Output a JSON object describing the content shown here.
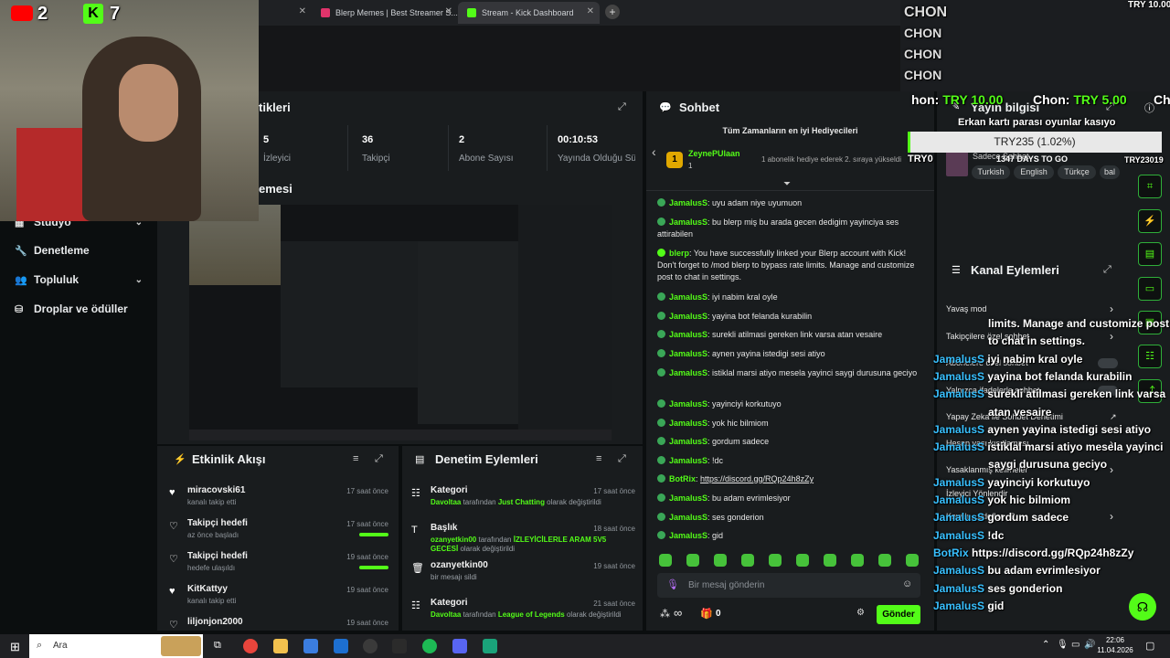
{
  "browser": {
    "tabs": [
      {
        "label": "Blerp Memes | Best Streamer S..."
      },
      {
        "label": "Stream - Kick Dashboard"
      }
    ]
  },
  "counters": {
    "youtube": "2",
    "kick": "7"
  },
  "sidebar": {
    "items": [
      {
        "label": "Stüdyo",
        "icon": "studio-icon"
      },
      {
        "label": "Denetleme",
        "icon": "wrench-icon"
      },
      {
        "label": "Topluluk",
        "icon": "community-icon"
      },
      {
        "label": "Droplar ve ödüller",
        "icon": "drops-icon"
      }
    ]
  },
  "stats": {
    "title": "tikleri",
    "items": [
      {
        "value": "5",
        "label": "İzleyici"
      },
      {
        "value": "36",
        "label": "Takipçi"
      },
      {
        "value": "2",
        "label": "Abone Sayısı"
      },
      {
        "value": "00:10:53",
        "label": "Yayında Olduğu Süre"
      }
    ]
  },
  "preview": {
    "title": "emesi"
  },
  "activity": {
    "title": "Etkinlik Akışı",
    "items": [
      {
        "name": "miracovski61",
        "sub": "kanalı takip etti",
        "time": "17 saat önce",
        "bar": 0
      },
      {
        "name": "Takipçi hedefi",
        "sub": "az önce başladı",
        "time": "17 saat önce",
        "bar": 1
      },
      {
        "name": "Takipçi hedefi",
        "sub": "hedefe ulaşıldı",
        "time": "19 saat önce",
        "bar": 1
      },
      {
        "name": "KitKattyy",
        "sub": "kanalı takip etti",
        "time": "19 saat önce",
        "bar": 0
      },
      {
        "name": "liljonjon2000",
        "sub": "",
        "time": "19 saat önce",
        "bar": 0
      }
    ]
  },
  "moderation": {
    "title": "Denetim Eylemleri",
    "items": [
      {
        "title": "Kategori",
        "user": "Davoltaa",
        "mid": " tarafından ",
        "value": "Just Chatting",
        "end": " olarak değiştirildi",
        "time": "17 saat önce"
      },
      {
        "title": "Başlık",
        "user": "ozanyetkin00",
        "mid": " tarafından ",
        "value": "İZLEYİCİLERLE ARAM 5V5 GECESİ",
        "end": " olarak değiştirildi",
        "time": "18 saat önce"
      },
      {
        "title": "ozanyetkin00",
        "user": "",
        "mid": "bir mesajı sildi",
        "value": "",
        "end": "",
        "time": "19 saat önce"
      },
      {
        "title": "Kategori",
        "user": "Davoltaa",
        "mid": " tarafından ",
        "value": "League of Legends",
        "end": " olarak değiştirildi",
        "time": "21 saat önce"
      }
    ]
  },
  "chat": {
    "title": "Sohbet",
    "top_gifters_title": "Tüm Zamanların en iyi Hediyecileri",
    "top_gifter": {
      "rank": "1",
      "name": "ZeynePUlaan",
      "count": "1",
      "note": "1 abonelik hediye ederek 2. sıraya yükseldi"
    },
    "messages": [
      {
        "user": "JamalusS",
        "text": "uyu adam niye uyumuon"
      },
      {
        "user": "JamalusS",
        "text": "bu blerp miş bu arada gecen dedigim yayinciya ses attirabilen"
      },
      {
        "user": "blerp",
        "text": "You have successfully linked your Blerp account with Kick! Don't forget to /mod blerp to bypass rate limits. Manage and customize post to chat in settings."
      },
      {
        "user": "JamalusS",
        "text": "iyi nabim kral oyle"
      },
      {
        "user": "JamalusS",
        "text": "yayina bot felanda kurabilin"
      },
      {
        "user": "JamalusS",
        "text": "surekli atilmasi gereken link varsa atan vesaire"
      },
      {
        "user": "JamalusS",
        "text": "aynen yayina istedigi sesi atiyo"
      },
      {
        "user": "JamalusS",
        "text": "istiklal marsi atiyo mesela yayinci saygi durusuna geciyo"
      },
      {
        "user": "JamalusS",
        "text": "yayinciyi korkutuyo"
      },
      {
        "user": "JamalusS",
        "text": "yok hic bilmiom"
      },
      {
        "user": "JamalusS",
        "text": "gordum sadece"
      },
      {
        "user": "JamalusS",
        "text": "!dc"
      },
      {
        "user": "BotRix",
        "text": "https://discord.gg/RQp24h8zZy"
      },
      {
        "user": "JamalusS",
        "text": "bu adam evrimlesiyor"
      },
      {
        "user": "JamalusS",
        "text": "ses gonderion"
      },
      {
        "user": "JamalusS",
        "text": "gid"
      }
    ],
    "input_placeholder": "Bir mesaj gönderin",
    "infinity": "∞",
    "gift_count": "0",
    "send_label": "Gönder"
  },
  "stream_info": {
    "title": "Yayın bilgisi",
    "subtitle": "Sadece Sohbet",
    "stream_title": "1347 DAYS TO GO",
    "tags": [
      "Turkish",
      "English",
      "Türkçe",
      "bal"
    ]
  },
  "channel_actions": {
    "title": "Kanal Eylemleri",
    "items": [
      {
        "label": "Yavaş mod",
        "control": "chevron"
      },
      {
        "label": "Takipçilere özel sohbet",
        "control": "chevron"
      },
      {
        "label": "Abonelere özel sohbet",
        "control": "toggle"
      },
      {
        "label": "Yalnızca ifadelerle sohbet",
        "control": "toggle"
      },
      {
        "label": "Yapay Zeka ile Sohbet Denetimi",
        "control": "link"
      },
      {
        "label": "Hesap yaşı kısıtlaması",
        "control": "chevron"
      },
      {
        "label": "Yasaklanmış kelimeler",
        "control": "chevron"
      },
      {
        "label": "İzleyici Yönlendir",
        "control": ""
      },
      {
        "label": "Kayıtlı ...edefler - 2",
        "control": "chevron"
      }
    ]
  },
  "overlay": {
    "names": [
      "CHON",
      "CHON",
      "CHON",
      "CHON"
    ],
    "try_top": "TRY 10.00",
    "ticker": [
      {
        "user": "hon:",
        "amount": "TRY 10.00"
      },
      {
        "user": "Chon:",
        "amount": "TRY 5.00"
      },
      {
        "user": "Ch",
        "amount": ""
      }
    ],
    "goal_title": "Erkan kartı parası oyunlar kasıyo",
    "goal_value": "TRY235 (1.02%)",
    "goal_progress": 0.0102,
    "goal_left": "TRY0",
    "goal_right": "TRY23019",
    "chat_lines": [
      {
        "user": "",
        "text": "limits. Manage and customize post"
      },
      {
        "user": "",
        "text": "to chat in settings."
      },
      {
        "user": "JamalusS",
        "text": "iyi nabim kral oyle"
      },
      {
        "user": "JamalusS",
        "text": "yayina bot felanda kurabilin"
      },
      {
        "user": "JamalusS",
        "text": "surekli atilmasi gereken link varsa"
      },
      {
        "user": "",
        "text": "atan vesaire"
      },
      {
        "user": "JamalusS",
        "text": "aynen yayina istedigi sesi atiyo"
      },
      {
        "user": "JamalusS",
        "text": "istiklal marsi atiyo mesela yayinci"
      },
      {
        "user": "",
        "text": "saygi durusuna geciyo"
      },
      {
        "user": "JamalusS",
        "text": "yayinciyi korkutuyo"
      },
      {
        "user": "JamalusS",
        "text": "yok hic bilmiom"
      },
      {
        "user": "JamalusS",
        "text": "gordum sadece"
      },
      {
        "user": "JamalusS",
        "text": "!dc"
      },
      {
        "user": "BotRix",
        "text": "https://discord.gg/RQp24h8zZy"
      },
      {
        "user": "JamalusS",
        "text": "bu adam evrimlesiyor"
      },
      {
        "user": "JamalusS",
        "text": "ses gonderion"
      },
      {
        "user": "JamalusS",
        "text": "gid"
      }
    ]
  },
  "taskbar": {
    "search_label": "Ara",
    "time": "22:06",
    "date": "11.04.2026"
  },
  "colors": {
    "kick_green": "#53fc18",
    "panel": "#191c1e",
    "background": "#0b0e0f",
    "username_blue": "#38c0ff"
  }
}
